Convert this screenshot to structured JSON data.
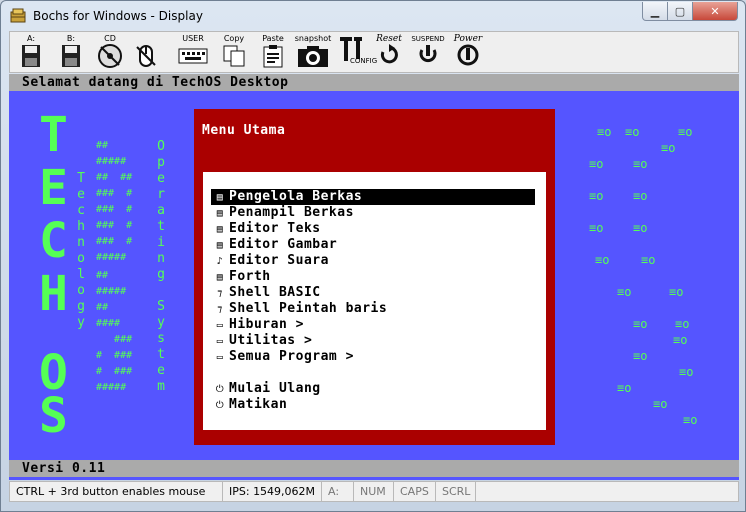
{
  "window": {
    "title": "Bochs for Windows - Display"
  },
  "toolbar": {
    "drive_a": "A:",
    "drive_b": "B:",
    "cd": "CD",
    "user": "USER",
    "copy": "Copy",
    "paste": "Paste",
    "snapshot": "snapshot",
    "config": "CONFIG",
    "reset": "Reset",
    "suspend": "SUSPEND",
    "power": "Power"
  },
  "screen": {
    "header": "Selamat datang di TechOS Desktop",
    "footer": "Versi 0.11",
    "logo_big": [
      "T",
      "E",
      "C",
      "H",
      "O",
      "S"
    ],
    "logo_word1": "Technology",
    "logo_word2": "Operating System",
    "menu": {
      "title": "Menu Utama",
      "items": [
        {
          "icon": "▤",
          "label": "Pengelola Berkas",
          "selected": true
        },
        {
          "icon": "▤",
          "label": "Penampil Berkas"
        },
        {
          "icon": "▤",
          "label": "Editor Teks"
        },
        {
          "icon": "▤",
          "label": "Editor Gambar"
        },
        {
          "icon": "♪",
          "label": "Editor Suara"
        },
        {
          "icon": "▤",
          "label": "Forth"
        },
        {
          "icon": "⁊",
          "label": "Shell BASIC"
        },
        {
          "icon": "⁊",
          "label": "Shell Peintah baris"
        },
        {
          "icon": "▭",
          "label": "Hiburan >"
        },
        {
          "icon": "▭",
          "label": "Utilitas >"
        },
        {
          "icon": "▭",
          "label": "Semua Program >"
        },
        {
          "icon": "⏻",
          "label": "Mulai Ulang"
        },
        {
          "icon": "⏻",
          "label": "Matikan"
        }
      ]
    },
    "deco_symbol": "≡o"
  },
  "status": {
    "hint": "CTRL + 3rd button enables mouse",
    "ips": "IPS: 1549,062M",
    "drive": "A:",
    "num": "NUM",
    "caps": "CAPS",
    "scrl": "SCRL"
  }
}
